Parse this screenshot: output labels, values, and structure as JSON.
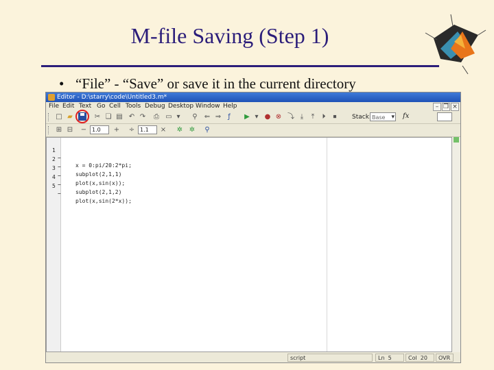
{
  "slide": {
    "title": "M-file Saving (Step 1)",
    "bullet": "“File” - “Save” or save it in the current directory"
  },
  "editor": {
    "window_title": "Editor - D:\\starry\\code\\Untitled3.m*",
    "menu": [
      "File",
      "Edit",
      "Text",
      "Go",
      "Cell",
      "Tools",
      "Debug",
      "Desktop",
      "Window",
      "Help"
    ],
    "toolbar": {
      "stack_label": "Stack:",
      "stack_value": "Base",
      "fx_label": "fx",
      "cell_minus": "−",
      "cell_value1": "1.0",
      "cell_plus": "+",
      "cell_divide": "÷",
      "cell_value2": "1.1",
      "cell_close": "×"
    },
    "code_lines": [
      {
        "num": "1",
        "dash": "−",
        "code": "x = 0:pi/20:2*pi;"
      },
      {
        "num": "2",
        "dash": "−",
        "code": "subplot(2,1,1)"
      },
      {
        "num": "3",
        "dash": "−",
        "code": "plot(x,sin(x));"
      },
      {
        "num": "4",
        "dash": "−",
        "code": "subplot(2,1,2)"
      },
      {
        "num": "5",
        "dash": "−",
        "code": "plot(x,sin(2*x));"
      }
    ],
    "status": {
      "mode": "script",
      "ln_label": "Ln",
      "ln_value": "5",
      "col_label": "Col",
      "col_value": "20",
      "ovr": "OVR"
    }
  },
  "colors": {
    "slide_bg": "#fbf3dc",
    "title_color": "#2b1d7a",
    "highlight_circle": "#e02020"
  }
}
